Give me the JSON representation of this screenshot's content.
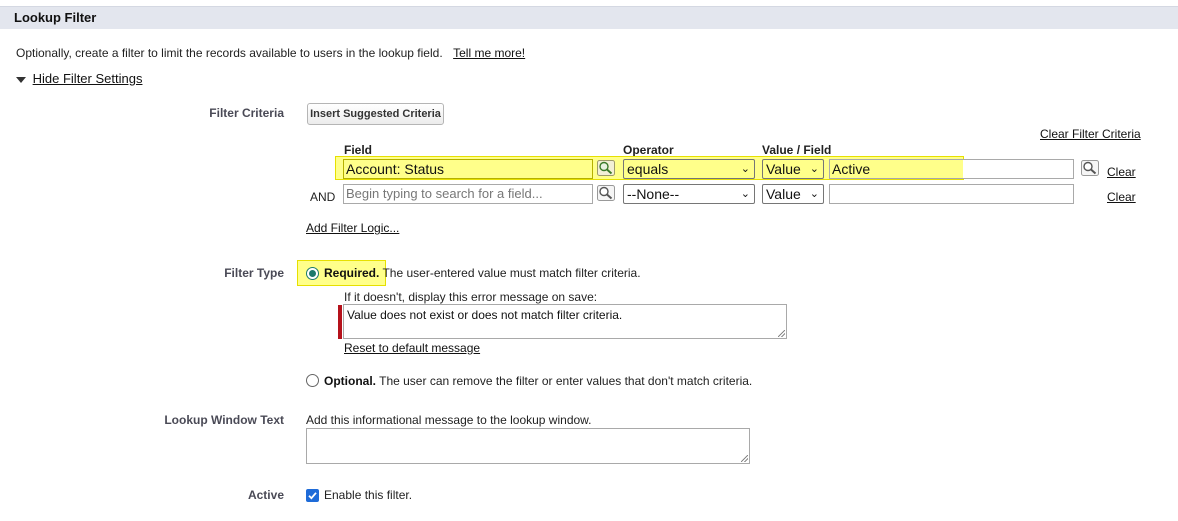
{
  "section": {
    "title": "Lookup Filter"
  },
  "intro": {
    "text": "Optionally, create a filter to limit the records available to users in the lookup field.",
    "tell_me_more": "Tell me more!"
  },
  "hide_settings": {
    "label": "Hide Filter Settings"
  },
  "filter_criteria": {
    "label": "Filter Criteria",
    "insert_button": "Insert Suggested Criteria",
    "clear_all": "Clear Filter Criteria",
    "headers": {
      "field": "Field",
      "operator": "Operator",
      "value_field": "Value / Field"
    },
    "rows": [
      {
        "prefix": "",
        "field": "Account: Status",
        "operator": "equals",
        "value_type": "Value",
        "value": "Active",
        "clear": "Clear",
        "highlighted": true
      },
      {
        "prefix": "AND",
        "field_placeholder": "Begin typing to search for a field...",
        "operator": "--None--",
        "value_type": "Value",
        "value": "",
        "clear": "Clear",
        "highlighted": false
      }
    ],
    "add_logic": "Add Filter Logic..."
  },
  "filter_type": {
    "label": "Filter Type",
    "required": {
      "title": "Required.",
      "desc": "The user-entered value must match filter criteria.",
      "selected": true
    },
    "error_prompt": "If it doesn't, display this error message on save:",
    "error_message": "Value does not exist or does not match filter criteria.",
    "reset_link": "Reset to default message",
    "optional": {
      "title": "Optional.",
      "desc": "The user can remove the filter or enter values that don't match criteria.",
      "selected": false
    }
  },
  "lookup_window": {
    "label": "Lookup Window Text",
    "prompt": "Add this informational message to the lookup window.",
    "value": ""
  },
  "active": {
    "label": "Active",
    "checkbox_label": "Enable this filter.",
    "checked": true
  },
  "colors": {
    "highlight": "#ffff8a",
    "radio": "#1c7a6b",
    "checkbox": "#1e6bd8",
    "error_bar": "#b5121b",
    "header_bg": "#e3e6ee"
  }
}
